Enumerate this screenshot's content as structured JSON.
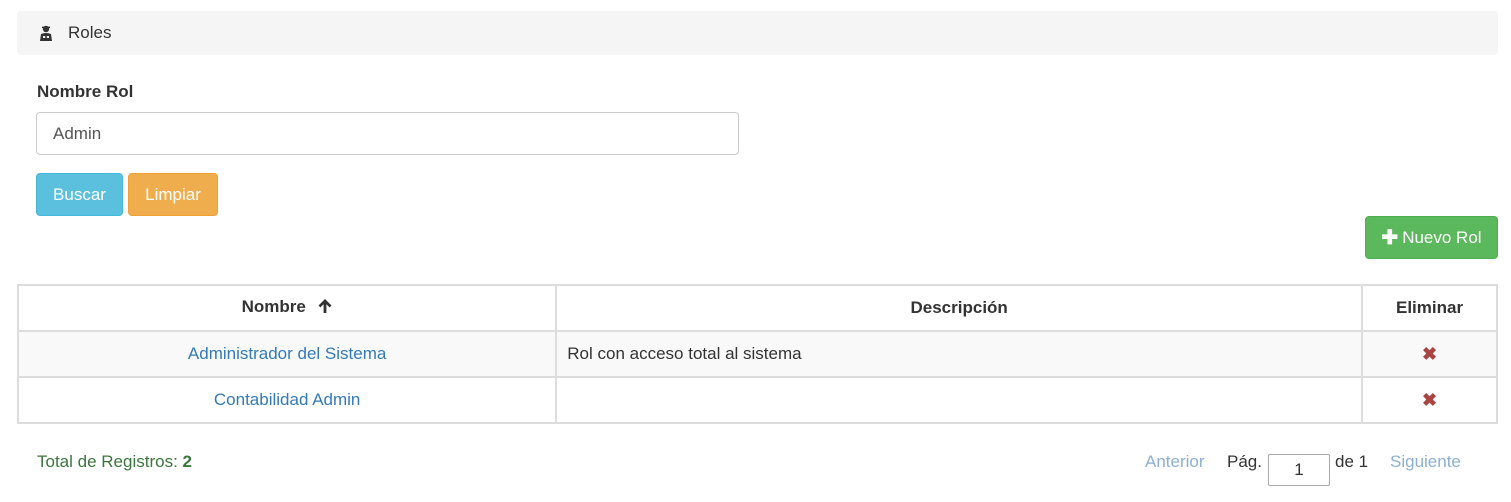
{
  "breadcrumb": {
    "icon": "user-secret-icon",
    "title": "Roles"
  },
  "filter": {
    "label": "Nombre Rol",
    "value": "Admin",
    "search_button": "Buscar",
    "clear_button": "Limpiar"
  },
  "new_button": {
    "icon": "plus-icon",
    "label": "Nuevo Rol"
  },
  "table": {
    "headers": {
      "name": "Nombre",
      "description": "Descripción",
      "delete": "Eliminar"
    },
    "sort_icon": "arrow-up-icon",
    "rows": [
      {
        "name": "Administrador del Sistema",
        "description": "Rol con acceso total al sistema",
        "delete_icon": "remove-icon"
      },
      {
        "name": "Contabilidad Admin",
        "description": "",
        "delete_icon": "remove-icon"
      }
    ]
  },
  "footer": {
    "total_label": "Total de Registros:",
    "total_count": "2"
  },
  "pagination": {
    "prev": "Anterior",
    "page_label": "Pág.",
    "current_page": "1",
    "of_label": "de 1",
    "next": "Siguiente"
  },
  "colors": {
    "info": "#5bc0de",
    "warning": "#f0ad4e",
    "success": "#5cb85c",
    "link": "#337ab7",
    "danger": "#a94442",
    "total_text": "#3c763d"
  }
}
